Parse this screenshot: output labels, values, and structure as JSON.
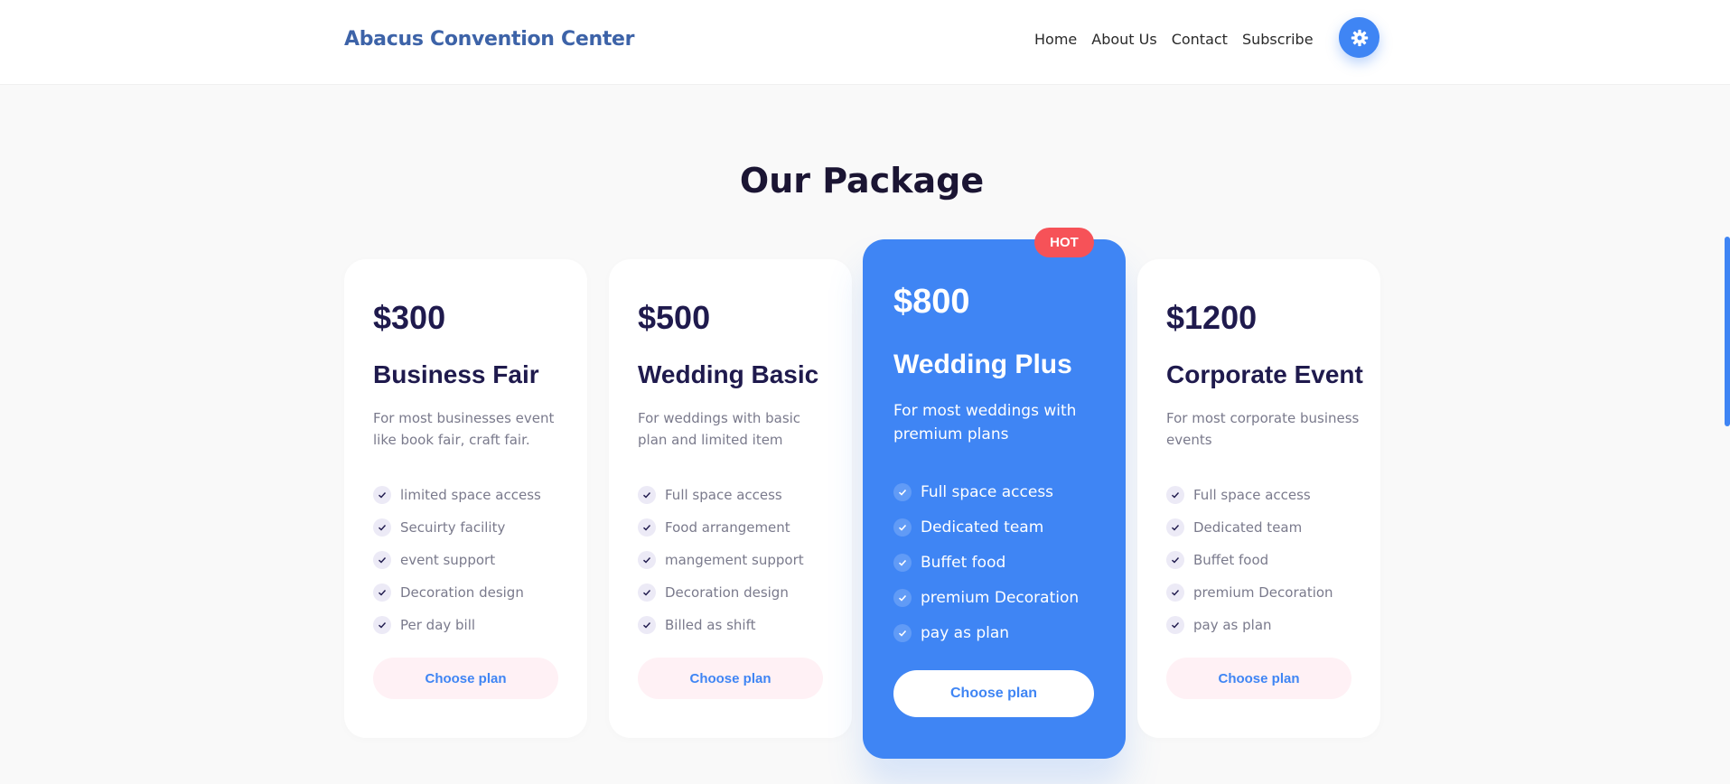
{
  "brand": "Abacus Convention Center",
  "nav": {
    "home": "Home",
    "about": "About Us",
    "contact": "Contact",
    "subscribe": "Subscribe"
  },
  "settings_icon": "gear-icon",
  "section_title": "Our Package",
  "hot_badge": "HOT",
  "colors": {
    "accent": "#3f85f4",
    "hot": "#f65258",
    "heading": "#1f1a4d",
    "brand": "#3d63a8"
  },
  "packages": [
    {
      "price": "$300",
      "name": "Business Fair",
      "desc": "For most businesses event like book fair, craft fair.",
      "features": [
        "limited space access",
        "Secuirty facility",
        "event support",
        "Decoration design",
        "Per day bill"
      ],
      "button": "Choose plan"
    },
    {
      "price": "$500",
      "name": "Wedding Basic",
      "desc": "For weddings with basic plan and limited item",
      "features": [
        "Full space access",
        "Food arrangement",
        "mangement support",
        "Decoration design",
        "Billed as shift"
      ],
      "button": "Choose plan"
    },
    {
      "price": "$800",
      "name": "Wedding Plus",
      "desc": "For most weddings with premium plans",
      "features": [
        "Full space access",
        "Dedicated team",
        "Buffet food",
        "premium Decoration",
        "pay as plan"
      ],
      "button": "Choose plan"
    },
    {
      "price": "$1200",
      "name": "Corporate Event",
      "desc": "For most corporate business events",
      "features": [
        "Full space access",
        "Dedicated team",
        "Buffet food",
        "premium Decoration",
        "pay as plan"
      ],
      "button": "Choose plan"
    }
  ]
}
